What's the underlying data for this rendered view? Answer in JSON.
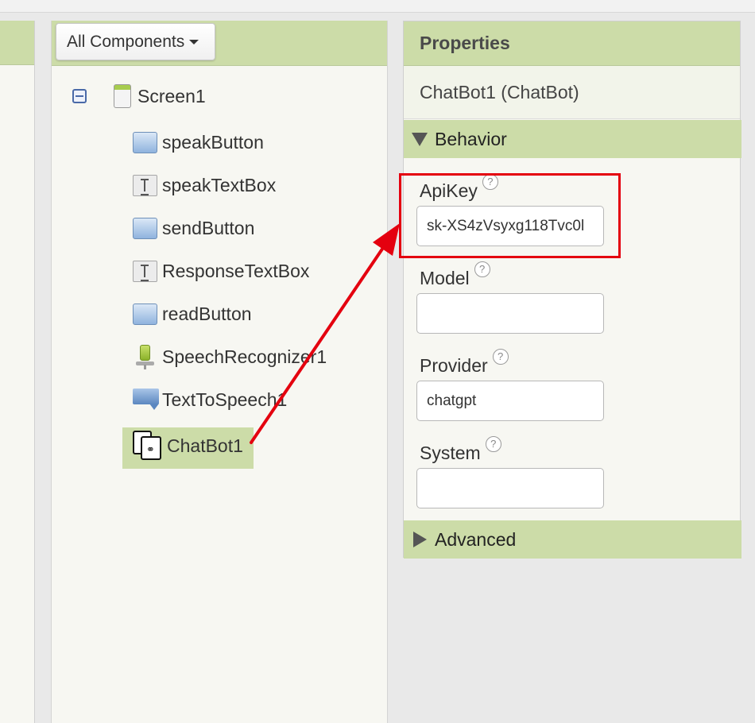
{
  "components_panel": {
    "dropdown_label": "All Components",
    "tree": [
      {
        "label": "Screen1",
        "icon": "screen-icon"
      },
      {
        "label": "speakButton",
        "icon": "button-icon"
      },
      {
        "label": "speakTextBox",
        "icon": "textbox-icon"
      },
      {
        "label": "sendButton",
        "icon": "button-icon"
      },
      {
        "label": "ResponseTextBox",
        "icon": "textbox-icon"
      },
      {
        "label": "readButton",
        "icon": "button-icon"
      },
      {
        "label": "SpeechRecognizer1",
        "icon": "microphone-icon"
      },
      {
        "label": "TextToSpeech1",
        "icon": "speech-bubble-icon"
      },
      {
        "label": "ChatBot1",
        "icon": "chatbot-icon",
        "selected": true
      }
    ]
  },
  "properties_panel": {
    "title": "Properties",
    "component_name": "ChatBot1 (ChatBot)",
    "behavior_label": "Behavior",
    "advanced_label": "Advanced",
    "help_glyph": "?",
    "fields": {
      "apikey": {
        "label": "ApiKey",
        "value": "sk-XS4zVsyxg118Tvc0l"
      },
      "model": {
        "label": "Model",
        "value": ""
      },
      "provider": {
        "label": "Provider",
        "value": "chatgpt"
      },
      "system": {
        "label": "System",
        "value": ""
      }
    }
  },
  "annotation": {
    "color": "#e4000f"
  },
  "colors": {
    "header_green": "#ccdca8",
    "panel_bg": "#f7f7f2"
  }
}
